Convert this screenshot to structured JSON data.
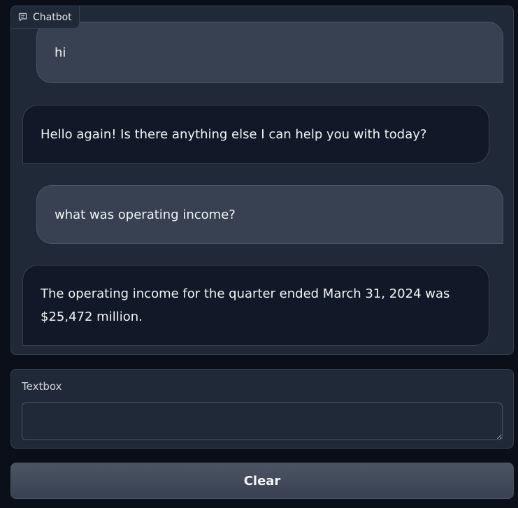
{
  "chatbot": {
    "label": "Chatbot",
    "label_icon": "chat-bubble-icon",
    "messages": [
      {
        "role": "user",
        "text": "hi"
      },
      {
        "role": "bot",
        "text": "Hello again! Is there anything else I can help you with today?"
      },
      {
        "role": "user",
        "text": "what was operating income?"
      },
      {
        "role": "bot",
        "text": "The operating income for the quarter ended March 31, 2024 was $25,472 million."
      }
    ]
  },
  "textbox": {
    "label": "Textbox",
    "value": "",
    "placeholder": ""
  },
  "clear_button": {
    "label": "Clear"
  }
}
